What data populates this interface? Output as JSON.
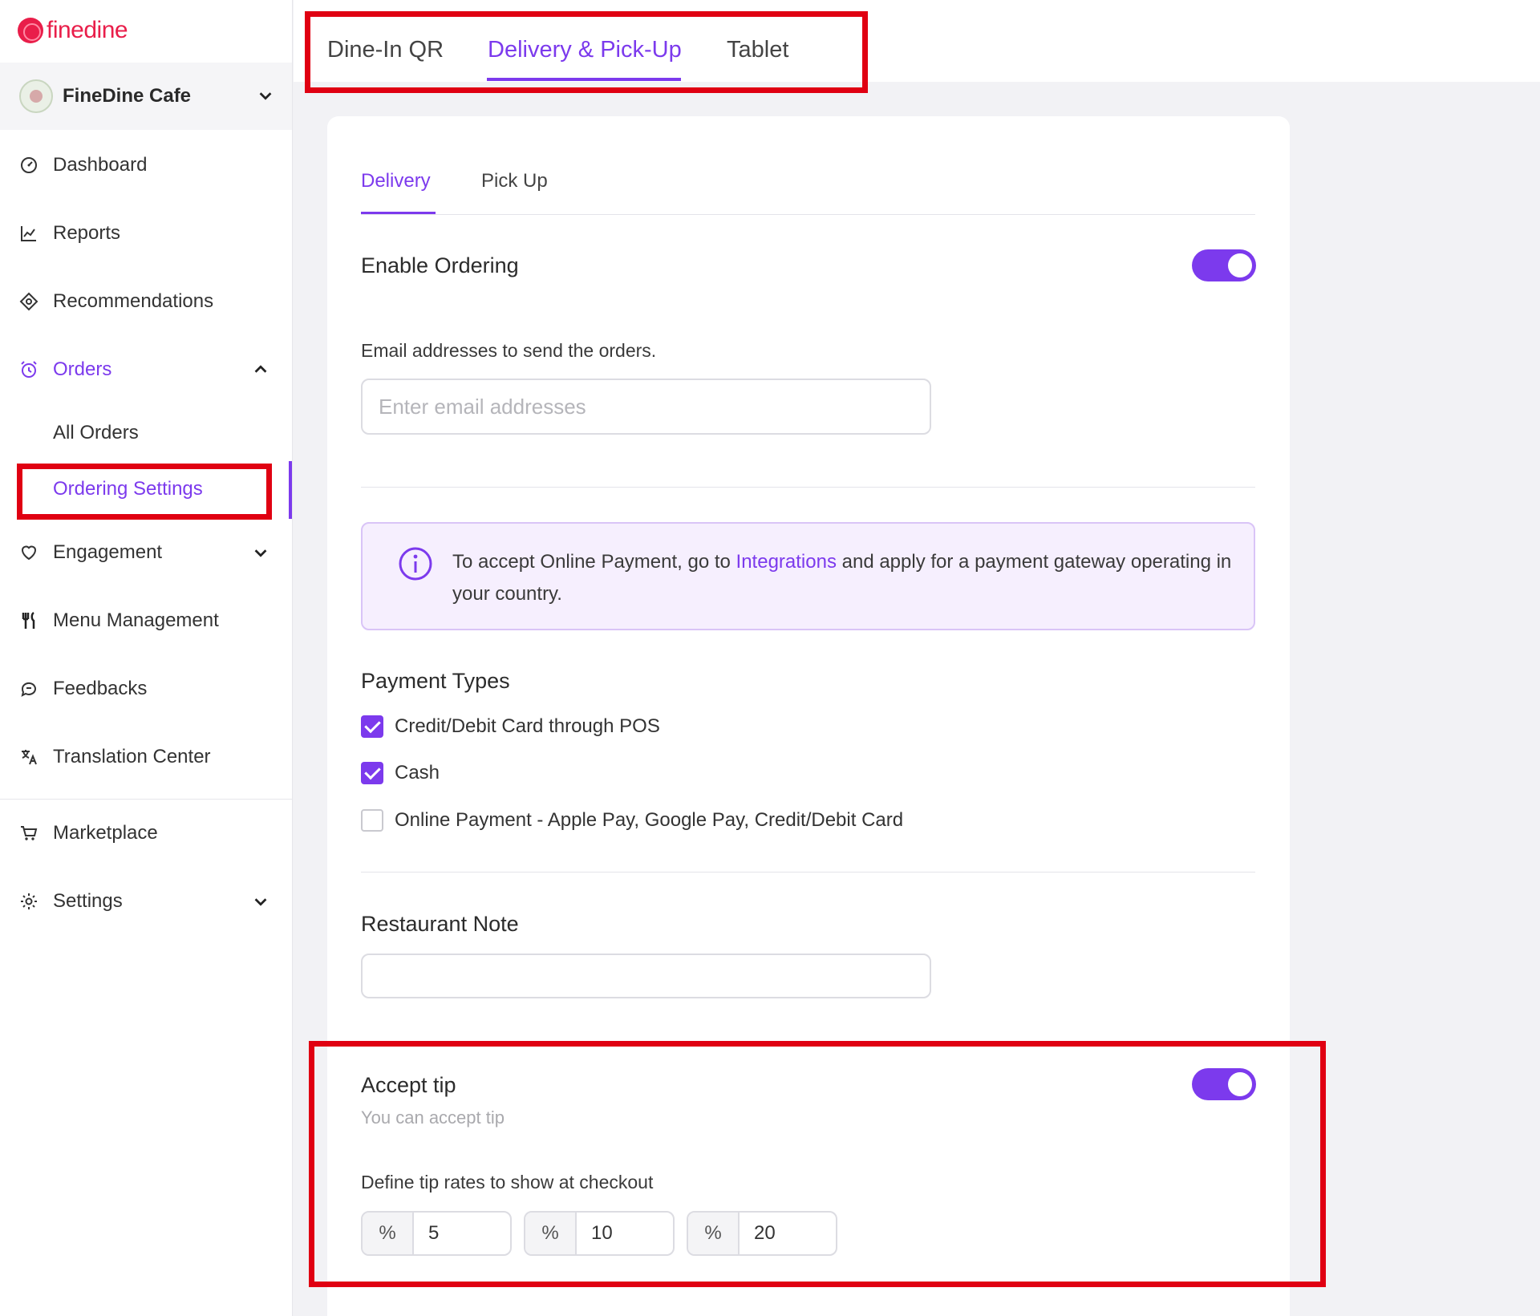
{
  "brand": {
    "name": "finedine",
    "color": "#e91e4a",
    "accent": "#7c3aed"
  },
  "venue": {
    "name": "FineDine Cafe"
  },
  "sidebar": {
    "items": [
      {
        "label": "Dashboard",
        "icon": "dashboard-icon"
      },
      {
        "label": "Reports",
        "icon": "chart-line-icon"
      },
      {
        "label": "Recommendations",
        "icon": "recommendations-icon"
      },
      {
        "label": "Orders",
        "icon": "alarm-icon",
        "expanded": true
      },
      {
        "label": "Engagement",
        "icon": "heart-icon"
      },
      {
        "label": "Menu Management",
        "icon": "fork-knife-icon"
      },
      {
        "label": "Feedbacks",
        "icon": "chat-bubble-icon"
      },
      {
        "label": "Translation Center",
        "icon": "translate-icon"
      },
      {
        "label": "Marketplace",
        "icon": "cart-icon"
      },
      {
        "label": "Settings",
        "icon": "gear-icon"
      }
    ],
    "orders_sub": [
      {
        "label": "All Orders"
      },
      {
        "label": "Ordering Settings",
        "active": true
      }
    ]
  },
  "top_tabs": [
    {
      "label": "Dine-In QR"
    },
    {
      "label": "Delivery & Pick-Up",
      "active": true
    },
    {
      "label": "Tablet"
    }
  ],
  "sub_tabs": [
    {
      "label": "Delivery",
      "active": true
    },
    {
      "label": "Pick Up"
    }
  ],
  "enable_ordering": {
    "label": "Enable Ordering",
    "on": true
  },
  "email": {
    "label": "Email addresses to send the orders.",
    "placeholder": "Enter email addresses",
    "value": ""
  },
  "info": {
    "before": "To accept Online Payment, go to ",
    "link": "Integrations",
    "after": " and apply for a payment gateway operating in your country."
  },
  "payment_types": {
    "title": "Payment Types",
    "options": [
      {
        "label": "Credit/Debit Card through POS",
        "checked": true
      },
      {
        "label": "Cash",
        "checked": true
      },
      {
        "label": "Online Payment - Apple Pay, Google Pay, Credit/Debit Card",
        "checked": false
      }
    ]
  },
  "restaurant_note": {
    "title": "Restaurant Note",
    "value": ""
  },
  "tip": {
    "title": "Accept tip",
    "subtitle": "You can accept tip",
    "on": true,
    "rates_label": "Define tip rates to show at checkout",
    "rates": [
      {
        "prefix": "%",
        "value": "5"
      },
      {
        "prefix": "%",
        "value": "10"
      },
      {
        "prefix": "%",
        "value": "20"
      }
    ]
  },
  "annotation_color": "#e00012"
}
